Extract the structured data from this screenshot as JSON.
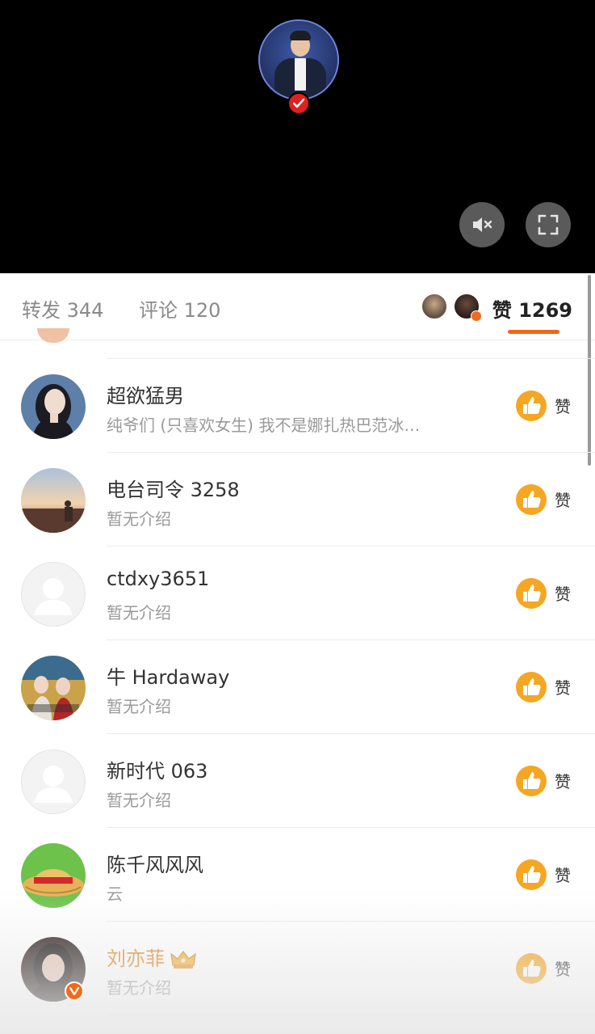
{
  "video": {
    "icons": [
      "live-avatar",
      "verified-check-icon",
      "mute-icon",
      "fullscreen-icon"
    ]
  },
  "tabs": {
    "repost": "转发 344",
    "comment": "评论 120",
    "like": "赞 1269",
    "accent_color": "#f2661a"
  },
  "likes": [
    {
      "name": "超欲猛男",
      "bio": "纯爷们 (只喜欢女生) 我不是娜扎热巴范冰…",
      "like_label": "赞"
    },
    {
      "name": "电台司令 3258",
      "bio": "暂无介绍",
      "like_label": "赞"
    },
    {
      "name": "ctdxy3651",
      "bio": "暂无介绍",
      "like_label": "赞"
    },
    {
      "name": "牛 Hardaway",
      "bio": "暂无介绍",
      "like_label": "赞"
    },
    {
      "name": "新时代 063",
      "bio": "暂无介绍",
      "like_label": "赞"
    },
    {
      "name": "陈千风风风",
      "bio": "云",
      "like_label": "赞"
    },
    {
      "name": "刘亦菲",
      "bio": "暂无介绍",
      "like_label": "赞",
      "vip": true
    }
  ],
  "colors": {
    "vip_name": "#e2871e",
    "like_icon": "#f5a623"
  }
}
